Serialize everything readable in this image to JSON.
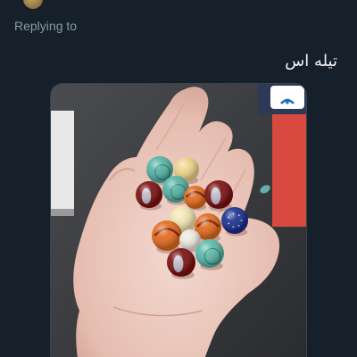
{
  "theme": {
    "background": "#15202b",
    "reply_prefix_color": "#8b98a5",
    "link_color": "#1d9bf0"
  },
  "reply": {
    "prefix": "Replying to",
    "handle": ""
  },
  "tweet": {
    "text": "تیله اس"
  },
  "media": {
    "alt": "",
    "icons": {
      "corner_logo": "wifi-logo-icon"
    },
    "marbles": [
      {
        "color": "#54b3a4",
        "kind": "glass"
      },
      {
        "color": "#eed28a",
        "kind": "opaque"
      },
      {
        "color": "#7a1010",
        "kind": "cat-eye"
      },
      {
        "color": "#54b3a4",
        "kind": "glass"
      },
      {
        "color": "#e26a1c",
        "kind": "swirl"
      },
      {
        "color": "#7a1010",
        "kind": "cat-eye"
      },
      {
        "color": "#1a2f8c",
        "kind": "sparkle"
      },
      {
        "color": "#f0e3b0",
        "kind": "opaque"
      },
      {
        "color": "#e26a1c",
        "kind": "swirl"
      },
      {
        "color": "#e26a1c",
        "kind": "swirl"
      },
      {
        "color": "#ece6dc",
        "kind": "opaque"
      },
      {
        "color": "#5bb8a8",
        "kind": "glass"
      },
      {
        "color": "#7a1010",
        "kind": "cat-eye"
      }
    ]
  }
}
